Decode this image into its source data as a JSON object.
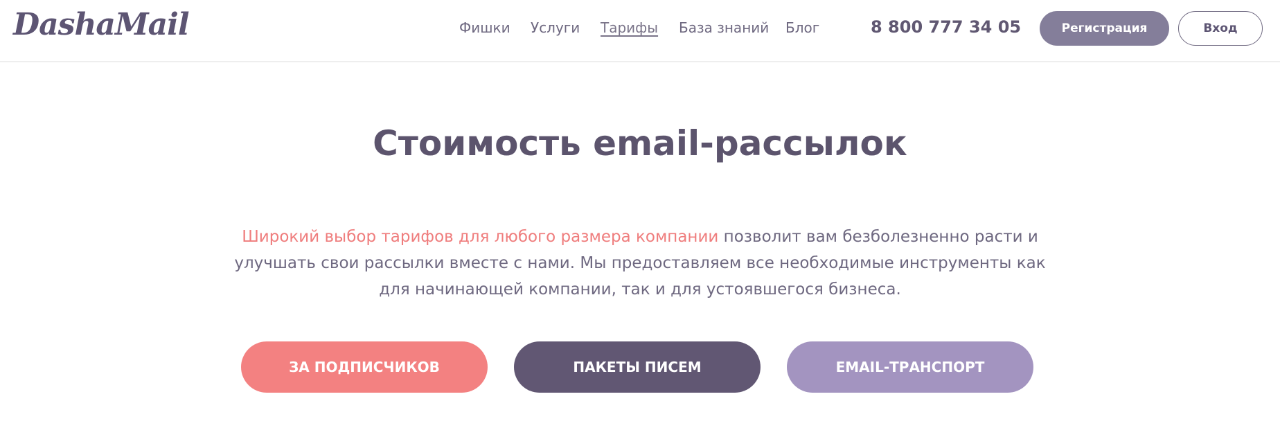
{
  "header": {
    "logo": "DashaMail",
    "nav": [
      {
        "label": "Фишки"
      },
      {
        "label": "Услуги"
      },
      {
        "label": "Тарифы",
        "active": true
      },
      {
        "label": "База знаний"
      },
      {
        "label": "Блог"
      }
    ],
    "phone": "8 800 777 34 05",
    "register_label": "Регистрация",
    "login_label": "Вход"
  },
  "hero": {
    "title": "Стоимость email-рассылок",
    "lead_accent": "Широкий выбор тарифов для любого размера компании",
    "lead_rest": " позволит вам безболезненно расти и улучшать свои рассылки вместе с нами. Мы предоставляем все необходимые инструменты как для начинающей компании, так и для устоявшегося бизнеса."
  },
  "tabs": [
    {
      "label": "ЗА ПОДПИСЧИКОВ",
      "color": "#f38181"
    },
    {
      "label": "ПАКЕТЫ ПИСЕМ",
      "color": "#615773"
    },
    {
      "label": "EMAIL-ТРАНСПОРТ",
      "color": "#a394c0"
    }
  ],
  "colors": {
    "brand_text": "#5d5573",
    "accent_text": "#ef7d7d",
    "register_bg": "#847e9a"
  }
}
